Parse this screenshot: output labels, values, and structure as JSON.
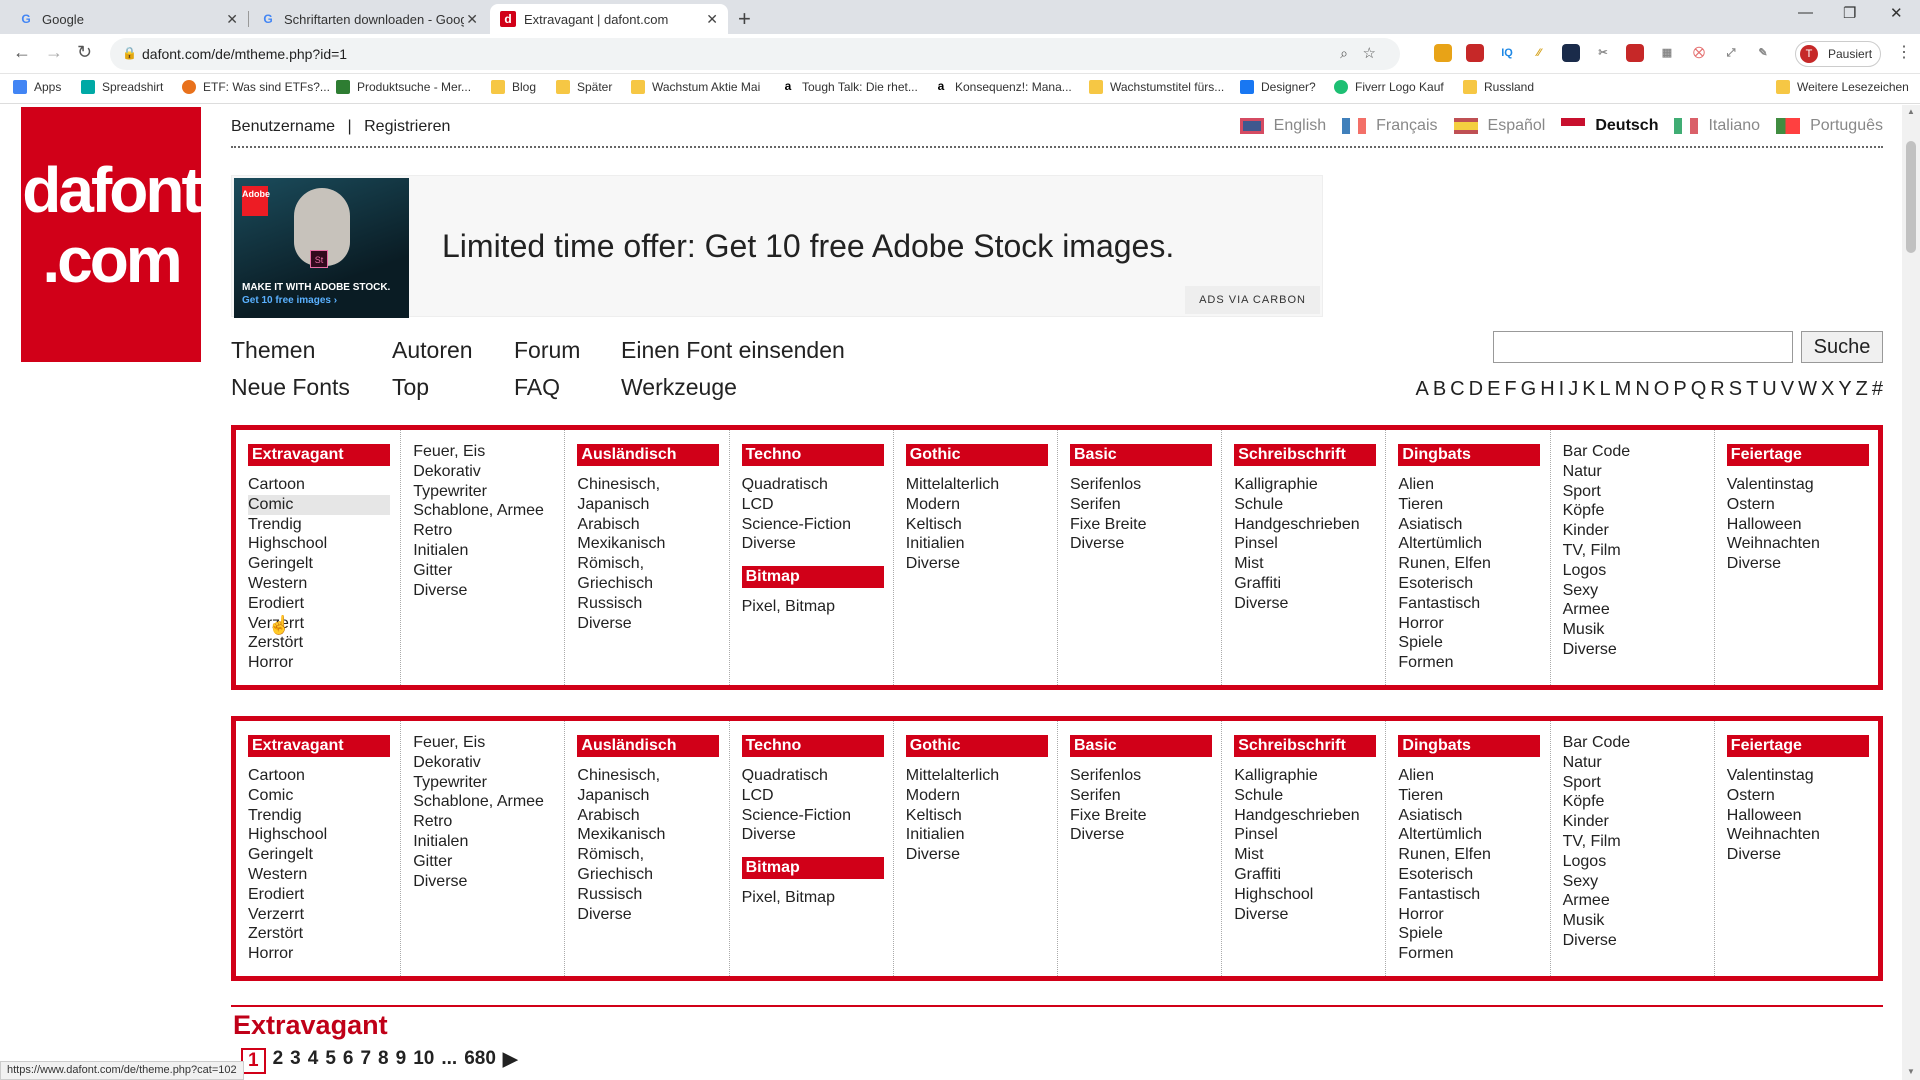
{
  "tabs": [
    {
      "title": "Google",
      "icon": "G"
    },
    {
      "title": "Schriftarten downloaden - Googl",
      "icon": "G"
    },
    {
      "title": "Extravagant | dafont.com",
      "icon": "d"
    }
  ],
  "browser": {
    "url": "dafont.com/de/mtheme.php?id=1",
    "profile_label": "Pausiert",
    "profile_initial": "T"
  },
  "bookmarks": [
    {
      "label": "Apps"
    },
    {
      "label": "Spreadshirt"
    },
    {
      "label": "ETF: Was sind ETFs?..."
    },
    {
      "label": "Produktsuche - Mer..."
    },
    {
      "label": "Blog"
    },
    {
      "label": "Später"
    },
    {
      "label": "Wachstum Aktie Mai"
    },
    {
      "label": "Tough Talk: Die rhet..."
    },
    {
      "label": "Konsequenz!: Mana..."
    },
    {
      "label": "Wachstumstitel fürs..."
    },
    {
      "label": "Designer?"
    },
    {
      "label": "Fiverr Logo Kauf"
    },
    {
      "label": "Russland"
    },
    {
      "label": "Weitere Lesezeichen"
    }
  ],
  "site": {
    "logo_line1": "dafont",
    "logo_line2": ".com",
    "username": "Benutzername",
    "divider": "|",
    "register": "Registrieren",
    "languages": [
      {
        "label": "English",
        "current": false
      },
      {
        "label": "Français",
        "current": false
      },
      {
        "label": "Español",
        "current": false
      },
      {
        "label": "Deutsch",
        "current": true
      },
      {
        "label": "Italiano",
        "current": false
      },
      {
        "label": "Português",
        "current": false
      }
    ],
    "ad": {
      "headline": "Limited time offer: Get 10 free Adobe Stock images.",
      "img_line1": "MAKE IT WITH ADOBE STOCK.",
      "img_line2": "Get 10 free images ›",
      "adobe": "Adobe",
      "st": "St",
      "via": "ADS VIA CARBON"
    },
    "nav": {
      "themen": "Themen",
      "autoren": "Autoren",
      "forum": "Forum",
      "einsenden": "Einen Font einsenden",
      "neue": "Neue Fonts",
      "top": "Top",
      "faq": "FAQ",
      "werkzeuge": "Werkzeuge"
    },
    "search_button": "Suche",
    "alphabet": [
      "A",
      "B",
      "C",
      "D",
      "E",
      "F",
      "G",
      "H",
      "I",
      "J",
      "K",
      "L",
      "M",
      "N",
      "O",
      "P",
      "Q",
      "R",
      "S",
      "T",
      "U",
      "V",
      "W",
      "X",
      "Y",
      "Z",
      "#"
    ]
  },
  "menu1": [
    {
      "header": "Extravagant",
      "items": [
        "Cartoon",
        "Comic",
        "Trendig",
        "Highschool",
        "Geringelt",
        "Western",
        "Erodiert",
        "Verzerrt",
        "Zerstört",
        "Horror"
      ]
    },
    {
      "header": "",
      "items": [
        "Feuer, Eis",
        "Dekorativ",
        "Typewriter",
        "Schablone, Armee",
        "Retro",
        "Initialen",
        "Gitter",
        "Diverse"
      ]
    },
    {
      "header": "Ausländisch",
      "items": [
        "Chinesisch,",
        "Japanisch",
        "Arabisch",
        "Mexikanisch",
        "Römisch,",
        "Griechisch",
        "Russisch",
        "Diverse"
      ]
    },
    {
      "header": "Techno",
      "items": [
        "Quadratisch",
        "LCD",
        "Science-Fiction",
        "Diverse"
      ],
      "header2": "Bitmap",
      "items2": [
        "Pixel, Bitmap"
      ]
    },
    {
      "header": "Gothic",
      "items": [
        "Mittelalterlich",
        "Modern",
        "Keltisch",
        "Initialien",
        "Diverse"
      ]
    },
    {
      "header": "Basic",
      "items": [
        "Serifenlos",
        "Serifen",
        "Fixe Breite",
        "Diverse"
      ]
    },
    {
      "header": "Schreibschrift",
      "items": [
        "Kalligraphie",
        "Schule",
        "Handgeschrieben",
        "Pinsel",
        "Mist",
        "Graffiti",
        "Diverse"
      ]
    },
    {
      "header": "Dingbats",
      "items": [
        "Alien",
        "Tieren",
        "Asiatisch",
        "Altertümlich",
        "Runen, Elfen",
        "Esoterisch",
        "Fantastisch",
        "Horror",
        "Spiele",
        "Formen"
      ]
    },
    {
      "header": "",
      "items": [
        "Bar Code",
        "Natur",
        "Sport",
        "Köpfe",
        "Kinder",
        "TV, Film",
        "Logos",
        "Sexy",
        "Armee",
        "Musik",
        "Diverse"
      ]
    },
    {
      "header": "Feiertage",
      "items": [
        "Valentinstag",
        "Ostern",
        "Halloween",
        "Weihnachten",
        "Diverse"
      ]
    }
  ],
  "menu2": [
    {
      "header": "Extravagant",
      "items": [
        "Cartoon",
        "Comic",
        "Trendig",
        "Highschool",
        "Geringelt",
        "Western",
        "Erodiert",
        "Verzerrt",
        "Zerstört",
        "Horror"
      ]
    },
    {
      "header": "",
      "items": [
        "Feuer, Eis",
        "Dekorativ",
        "Typewriter",
        "Schablone, Armee",
        "Retro",
        "Initialen",
        "Gitter",
        "Diverse"
      ]
    },
    {
      "header": "Ausländisch",
      "items": [
        "Chinesisch,",
        "Japanisch",
        "Arabisch",
        "Mexikanisch",
        "Römisch,",
        "Griechisch",
        "Russisch",
        "Diverse"
      ]
    },
    {
      "header": "Techno",
      "items": [
        "Quadratisch",
        "LCD",
        "Science-Fiction",
        "Diverse"
      ],
      "header2": "Bitmap",
      "items2": [
        "Pixel, Bitmap"
      ]
    },
    {
      "header": "Gothic",
      "items": [
        "Mittelalterlich",
        "Modern",
        "Keltisch",
        "Initialien",
        "Diverse"
      ]
    },
    {
      "header": "Basic",
      "items": [
        "Serifenlos",
        "Serifen",
        "Fixe Breite",
        "Diverse"
      ]
    },
    {
      "header": "Schreibschrift",
      "items": [
        "Kalligraphie",
        "Schule",
        "Handgeschrieben",
        "Pinsel",
        "Mist",
        "Graffiti",
        "Highschool",
        "Diverse"
      ]
    },
    {
      "header": "Dingbats",
      "items": [
        "Alien",
        "Tieren",
        "Asiatisch",
        "Altertümlich",
        "Runen, Elfen",
        "Esoterisch",
        "Fantastisch",
        "Horror",
        "Spiele",
        "Formen"
      ]
    },
    {
      "header": "",
      "items": [
        "Bar Code",
        "Natur",
        "Sport",
        "Köpfe",
        "Kinder",
        "TV, Film",
        "Logos",
        "Sexy",
        "Armee",
        "Musik",
        "Diverse"
      ]
    },
    {
      "header": "Feiertage",
      "items": [
        "Valentinstag",
        "Ostern",
        "Halloween",
        "Weihnachten",
        "Diverse"
      ]
    }
  ],
  "section": {
    "title": "Extravagant",
    "pages": [
      "1",
      "2",
      "3",
      "4",
      "5",
      "6",
      "7",
      "8",
      "9",
      "10",
      "...",
      "680"
    ],
    "next": "▶"
  },
  "statusbar": "https://www.dafont.com/de/theme.php?cat=102"
}
